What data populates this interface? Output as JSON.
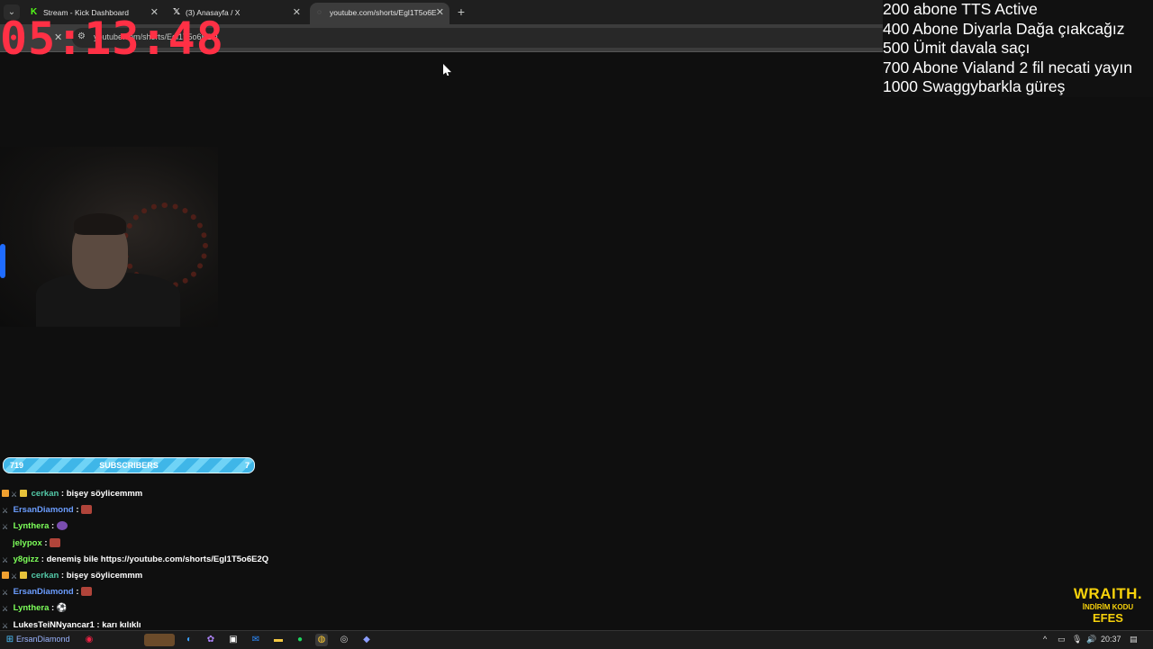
{
  "browser": {
    "tabs": [
      {
        "label": "Stream - Kick Dashboard",
        "favicon": "kick-icon",
        "active": false
      },
      {
        "label": "(3) Anasayfa / X",
        "favicon": "x-icon",
        "active": false
      },
      {
        "label": "youtube.com/shorts/Egl1T5o6E",
        "favicon": "loading-icon",
        "active": true
      }
    ],
    "address": "youtube.com/shorts/Egl1T5o6E2Q",
    "window_controls": [
      "minimize",
      "restore",
      "close"
    ]
  },
  "overlay": {
    "timer": "05:13:48",
    "goals": [
      "200 abone TTS Active",
      "400 Abone Diyarla Dağa çıakcağız",
      "500 Ümit davala saçı",
      "700 Abone Vialand 2 fil necati yayın",
      "1000 Swaggybarkla güreş"
    ],
    "subscriber_bar": {
      "left": "719",
      "label": "SUBSCRIBERS",
      "right": "7",
      "progress": 1.0
    },
    "brand": {
      "line1": "WRAITH.",
      "line2": "İNDİRİM KODU",
      "line3": "EFES"
    }
  },
  "chat": [
    {
      "badges": [
        "gift",
        "sword",
        "crown"
      ],
      "user": "cerkan",
      "user_color": "#53c9a8",
      "text": "bişey söylicemmm"
    },
    {
      "badges": [
        "sword"
      ],
      "user": "ErsanDiamond",
      "user_color": "#6b9dff",
      "text": "",
      "emote": true
    },
    {
      "badges": [
        "sword"
      ],
      "user": "Lynthera",
      "user_color": "#7dff5a",
      "text": "",
      "emote": true
    },
    {
      "badges": [],
      "user": "jelypox",
      "user_color": "#7dff5a",
      "text": "",
      "emote": true
    },
    {
      "badges": [
        "sword"
      ],
      "user": "y8gizz",
      "user_color": "#7dff5a",
      "text": "denemiş bile https://youtube.com/shorts/Egl1T5o6E2Q"
    },
    {
      "badges": [
        "gift",
        "sword",
        "crown"
      ],
      "user": "cerkan",
      "user_color": "#53c9a8",
      "text": "bişey söylicemmm"
    },
    {
      "badges": [
        "sword"
      ],
      "user": "ErsanDiamond",
      "user_color": "#6b9dff",
      "text": "",
      "emote": true
    },
    {
      "badges": [
        "sword"
      ],
      "user": "Lynthera",
      "user_color": "#7dff5a",
      "text": "",
      "emote": true
    },
    {
      "badges": [
        "sword"
      ],
      "user": "LukesTeiNNyancar1",
      "user_color": "#ffffff",
      "text": "karı kılıklı"
    }
  ],
  "taskbar": {
    "search_text": "ErsanDiamond",
    "clock": "20:37",
    "apps": [
      "edge-icon",
      "copilot-icon",
      "store-icon",
      "outlook-icon",
      "explorer-icon",
      "spotify-icon",
      "chrome-icon",
      "obs-icon",
      "discord-icon"
    ]
  }
}
